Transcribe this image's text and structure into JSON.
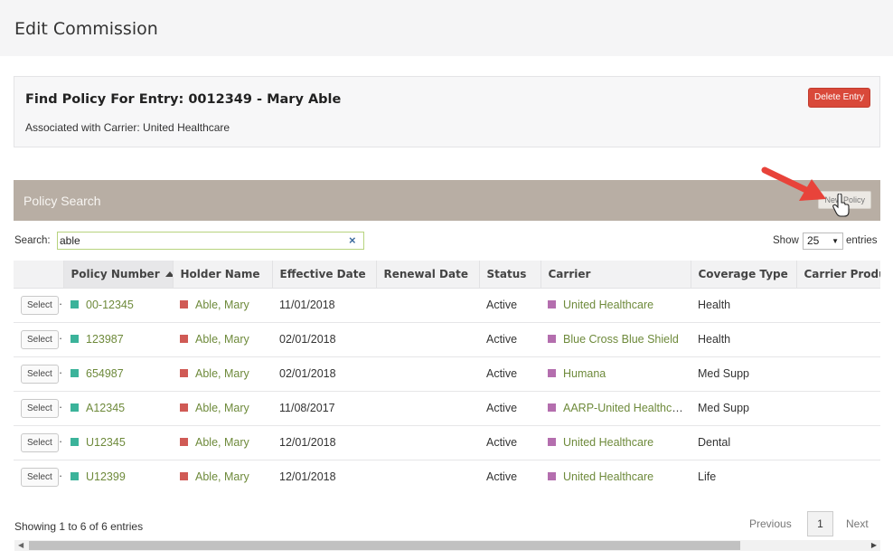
{
  "page": {
    "title": "Edit Commission"
  },
  "entry": {
    "title": "Find Policy For Entry: 0012349 - Mary Able",
    "subtitle": "Associated with Carrier: United Healthcare",
    "delete_label": "Delete Entry"
  },
  "policy_search": {
    "title": "Policy Search",
    "new_policy_label": "New Policy",
    "search_label": "Search:",
    "search_value": "able",
    "clear_icon": "×",
    "show_label": "Show",
    "page_size": "25",
    "entries_label": "entries"
  },
  "table": {
    "columns": [
      "",
      "Policy Number",
      "Holder Name",
      "Effective Date",
      "Renewal Date",
      "Status",
      "Carrier",
      "Coverage Type",
      "Carrier Product"
    ],
    "sorted_column": "Policy Number",
    "sort_direction": "ascending",
    "select_label": "Select",
    "rows": [
      {
        "policy": "00-12345",
        "holder": "Able, Mary",
        "effective": "11/01/2018",
        "renewal": "",
        "status": "Active",
        "carrier": "United Healthcare",
        "coverage": "Health",
        "product": ""
      },
      {
        "policy": "123987",
        "holder": "Able, Mary",
        "effective": "02/01/2018",
        "renewal": "",
        "status": "Active",
        "carrier": "Blue Cross Blue Shield",
        "coverage": "Health",
        "product": ""
      },
      {
        "policy": "654987",
        "holder": "Able, Mary",
        "effective": "02/01/2018",
        "renewal": "",
        "status": "Active",
        "carrier": "Humana",
        "coverage": "Med Supp",
        "product": ""
      },
      {
        "policy": "A12345",
        "holder": "Able, Mary",
        "effective": "11/08/2017",
        "renewal": "",
        "status": "Active",
        "carrier": "AARP-United Healthcare",
        "coverage": "Med Supp",
        "product": ""
      },
      {
        "policy": "U12345",
        "holder": "Able, Mary",
        "effective": "12/01/2018",
        "renewal": "",
        "status": "Active",
        "carrier": "United Healthcare",
        "coverage": "Dental",
        "product": ""
      },
      {
        "policy": "U12399",
        "holder": "Able, Mary",
        "effective": "12/01/2018",
        "renewal": "",
        "status": "Active",
        "carrier": "United Healthcare",
        "coverage": "Life",
        "product": ""
      }
    ]
  },
  "footer": {
    "info": "Showing 1 to 6 of 6 entries",
    "previous_label": "Previous",
    "current_page": "1",
    "next_label": "Next"
  },
  "colors": {
    "delete_button": "#d9493a",
    "search_header": "#b8aea4",
    "policy_square": "#3bb39a",
    "holder_square": "#d05a55",
    "carrier_square": "#b46eae",
    "link_text": "#6e8a3b",
    "annotation_arrow": "#e8433a"
  },
  "icons": {
    "sort": "sort-ascending-icon",
    "clear": "clear-search-icon",
    "annotation": "red-arrow-icon",
    "cursor": "hand-pointer-icon"
  }
}
